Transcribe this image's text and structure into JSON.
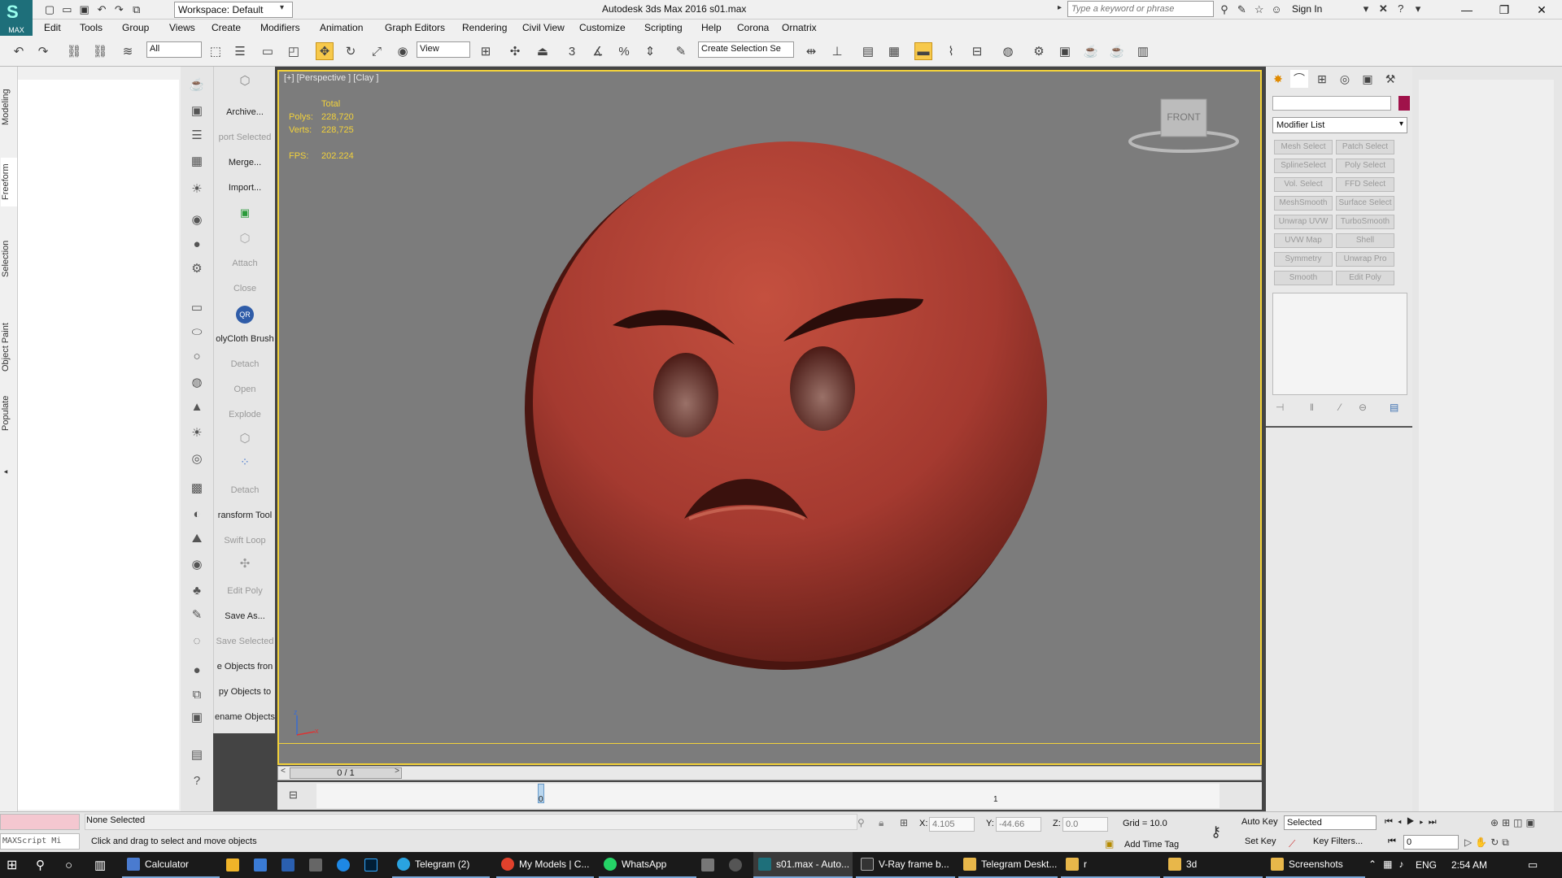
{
  "titlebar": {
    "logo_text": "MAX",
    "workspace": "Workspace: Default",
    "app_title": "Autodesk 3ds Max 2016      s01.max",
    "search_placeholder": "Type a keyword or phrase",
    "sign_in": "Sign In"
  },
  "menubar": [
    "Edit",
    "Tools",
    "Group",
    "Views",
    "Create",
    "Modifiers",
    "Animation",
    "Graph Editors",
    "Rendering",
    "Civil View",
    "Customize",
    "Scripting",
    "Help",
    "Corona",
    "Ornatrix"
  ],
  "toolbar": {
    "selection_filter": "All",
    "ref_coord": "View",
    "named_selection": "Create Selection Se",
    "snap_label": "3"
  },
  "ribbon_tabs": [
    "Modeling",
    "Freeform",
    "Selection",
    "Object Paint",
    "Populate"
  ],
  "command_labels": [
    {
      "label": "Archive...",
      "enabled": true
    },
    {
      "label": "port Selected",
      "enabled": false
    },
    {
      "label": "Merge...",
      "enabled": true
    },
    {
      "label": "Import...",
      "enabled": true
    },
    {
      "label": "",
      "enabled": false
    },
    {
      "label": "",
      "enabled": false
    },
    {
      "label": "Attach",
      "enabled": false
    },
    {
      "label": "Close",
      "enabled": false
    },
    {
      "label": "",
      "enabled": false
    },
    {
      "label": "olyCloth Brush",
      "enabled": true
    },
    {
      "label": "Detach",
      "enabled": false
    },
    {
      "label": "Open",
      "enabled": false
    },
    {
      "label": "Explode",
      "enabled": false
    },
    {
      "label": "",
      "enabled": false
    },
    {
      "label": "",
      "enabled": false
    },
    {
      "label": "Detach",
      "enabled": false
    },
    {
      "label": "ransform Tool",
      "enabled": true
    },
    {
      "label": "Swift Loop",
      "enabled": false
    },
    {
      "label": "",
      "enabled": false
    },
    {
      "label": "Edit Poly",
      "enabled": false
    },
    {
      "label": "Save As...",
      "enabled": true
    },
    {
      "label": "Save Selected",
      "enabled": false
    },
    {
      "label": "e Objects fron",
      "enabled": true
    },
    {
      "label": "py Objects to",
      "enabled": true
    },
    {
      "label": "ename Objects",
      "enabled": true
    }
  ],
  "viewport": {
    "label": "[+] [Perspective ] [Clay ]",
    "stats_header": "Total",
    "polys_label": "Polys:",
    "polys": "228,720",
    "verts_label": "Verts:",
    "verts": "228,725",
    "fps_label": "FPS:",
    "fps": "202.224",
    "viewcube_face": "FRONT",
    "axis_z": "z",
    "axis_x": "x",
    "model_color": "#b8453a"
  },
  "timeline": {
    "frame_display": "0 / 1",
    "tick_0": "0",
    "tick_1": "1"
  },
  "command_panel": {
    "modifier_list": "Modifier List",
    "object_color": "#a0124a",
    "modifier_buttons": [
      "Mesh Select",
      "Patch Select",
      "SplineSelect",
      "Poly Select",
      "Vol. Select",
      "FFD Select",
      "MeshSmooth",
      "Surface Select",
      "Unwrap UVW",
      "TurboSmooth",
      "UVW Map",
      "Shell",
      "Symmetry",
      "Unwrap Pro",
      "Smooth",
      "Edit Poly"
    ]
  },
  "statusbar": {
    "maxscript": "MAXScript Mi",
    "selection": "None Selected",
    "prompt": "Click and drag to select and move objects",
    "x_label": "X:",
    "x": "4.105",
    "y_label": "Y:",
    "y": "-44.66",
    "z_label": "Z:",
    "z": "0.0",
    "grid": "Grid = 10.0",
    "add_time_tag": "Add Time Tag",
    "auto_key": "Auto Key",
    "set_key": "Set Key",
    "key_mode": "Selected",
    "key_filters": "Key Filters...",
    "current_frame": "0"
  },
  "taskbar": {
    "items": [
      {
        "label": "Calculator",
        "color": "#4a7bd0",
        "open": true
      },
      {
        "label": "",
        "color": "#f0b429",
        "open": false
      },
      {
        "label": "",
        "color": "#3a7bd5",
        "open": false
      },
      {
        "label": "",
        "color": "#2a5fb0",
        "open": false
      },
      {
        "label": "",
        "color": "#666",
        "open": false
      },
      {
        "label": "",
        "color": "#1e88e5",
        "open": false
      },
      {
        "label": "",
        "color": "#001e36",
        "open": false
      },
      {
        "label": "Telegram (2)",
        "color": "#2aa3e0",
        "open": true
      },
      {
        "label": "My Models | C...",
        "color": "#e0412c",
        "open": true
      },
      {
        "label": "WhatsApp",
        "color": "#25d366",
        "open": true
      },
      {
        "label": "",
        "color": "#777",
        "open": false
      },
      {
        "label": "",
        "color": "#555",
        "open": false
      },
      {
        "label": "s01.max - Auto...",
        "color": "#1e6f7a",
        "open": true
      },
      {
        "label": "V-Ray frame b...",
        "color": "#333",
        "open": true
      },
      {
        "label": "Telegram Deskt...",
        "color": "#e8b74a",
        "open": true
      },
      {
        "label": "r",
        "color": "#e8b74a",
        "open": true
      },
      {
        "label": "3d",
        "color": "#e8b74a",
        "open": true
      },
      {
        "label": "Screenshots",
        "color": "#e8b74a",
        "open": true
      }
    ],
    "lang": "ENG",
    "time": "2:54 AM"
  }
}
